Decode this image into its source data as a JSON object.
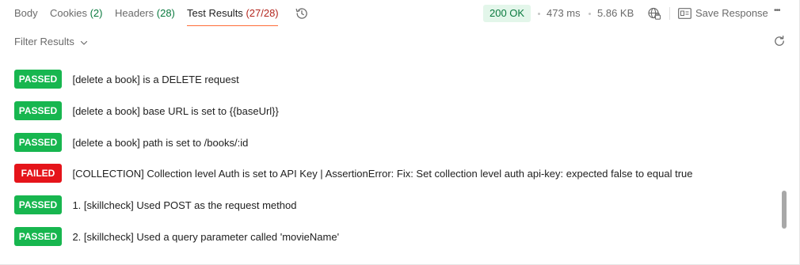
{
  "tabs": [
    {
      "label": "Body",
      "count": ""
    },
    {
      "label": "Cookies",
      "count": "(2)"
    },
    {
      "label": "Headers",
      "count": "(28)"
    },
    {
      "label": "Test Results",
      "count": "(27/28)"
    }
  ],
  "status": {
    "code": "200 OK",
    "time": "473 ms",
    "size": "5.86 KB"
  },
  "toolbar": {
    "save_label": "Save Response",
    "more_label": "•••"
  },
  "filter": {
    "label": "Filter Results"
  },
  "results": [
    {
      "status": "PASSED",
      "text": "[delete a book] is a DELETE request"
    },
    {
      "status": "PASSED",
      "text": "[delete a book] base URL is set to {{baseUrl}}"
    },
    {
      "status": "PASSED",
      "text": "[delete a book] path is set to /books/:id"
    },
    {
      "status": "FAILED",
      "text": "[COLLECTION] Collection level Auth is set to API Key | AssertionError: Fix: Set collection level auth api-key: expected false to equal true"
    },
    {
      "status": "PASSED",
      "text": "1. [skillcheck] Used POST as the request method"
    },
    {
      "status": "PASSED",
      "text": "2. [skillcheck] Used a query parameter called 'movieName'"
    }
  ],
  "colors": {
    "accent": "#ff6c37",
    "pass": "#17b64f",
    "fail": "#e5141a",
    "ok_bg": "#e3f6ea",
    "ok_text": "#0a7a3f"
  },
  "icons": [
    "history-icon",
    "globe-lock-icon",
    "save-response-icon",
    "more-icon",
    "chevron-down-icon",
    "refresh-icon"
  ]
}
